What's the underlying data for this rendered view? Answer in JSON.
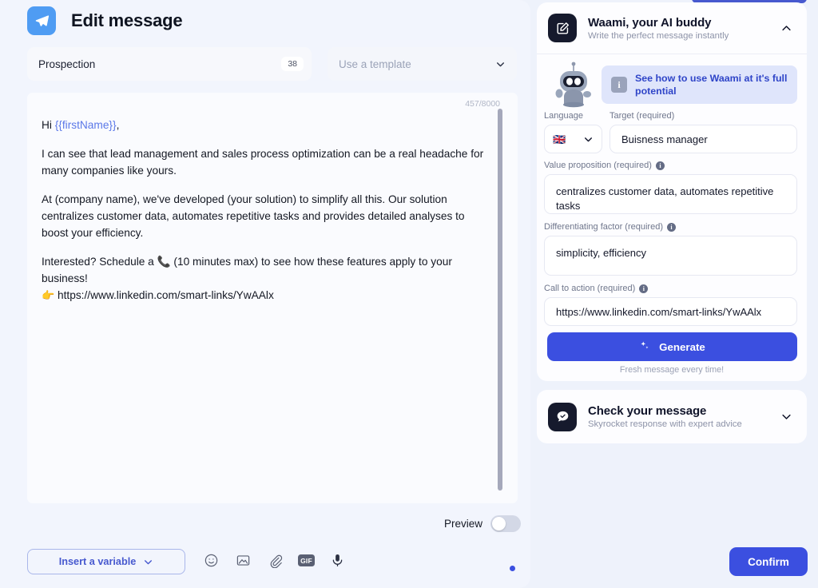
{
  "header": {
    "title": "Edit message",
    "logo_icon": "paper-plane-icon"
  },
  "subject": {
    "value": "Prospection",
    "char_count": "38"
  },
  "template": {
    "placeholder": "Use a template",
    "chevron_icon": "chevron-down-icon"
  },
  "editor": {
    "char_counter": "457/8000",
    "greeting_prefix": "Hi ",
    "variable_token": "{{firstName}}",
    "greeting_suffix": ",",
    "paragraph_1": "I can see that lead management and sales process optimization can be a real headache for many companies like yours.",
    "paragraph_2": "At (company name), we've developed (your solution) to simplify all this. Our solution centralizes customer data, automates repetitive tasks and provides detailed analyses to boost your efficiency.",
    "paragraph_3": "Interested? Schedule a 📞 (10 minutes max) to see how these features apply to your business!",
    "link_emoji": "👉",
    "link_text": "https://www.linkedin.com/smart-links/YwAAlx"
  },
  "preview": {
    "label": "Preview",
    "enabled": false
  },
  "toolbar": {
    "insert_variable_label": "Insert a variable",
    "icons": [
      {
        "name": "emoji-icon",
        "label": "Emoji"
      },
      {
        "name": "image-icon",
        "label": "Image"
      },
      {
        "name": "attachment-icon",
        "label": "Attachment"
      },
      {
        "name": "gif-icon",
        "label": "GIF"
      },
      {
        "name": "microphone-icon",
        "label": "Voice note"
      }
    ],
    "gif_label": "GIF",
    "confirm_label": "Confirm"
  },
  "waami": {
    "title": "Waami, your AI buddy",
    "subtitle": "Write the perfect message instantly",
    "badge_icon": "compose-square-icon",
    "collapse_icon": "chevron-up-icon",
    "mascot_icon": "robot-mascot-icon",
    "banner": {
      "icon": "info-icon",
      "text": "See how to use Waami at it's full potential"
    },
    "language": {
      "label": "Language",
      "flag_glyph": "🇬🇧",
      "chevron_icon": "chevron-down-icon"
    },
    "target": {
      "label": "Target (required)",
      "value": "Buisness manager"
    },
    "value_proposition": {
      "label": "Value proposition (required)",
      "info_icon": "info-icon",
      "value": "centralizes customer data, automates repetitive tasks"
    },
    "differentiating_factor": {
      "label": "Differentiating factor (required)",
      "info_icon": "info-icon",
      "value": "simplicity, efficiency"
    },
    "call_to_action": {
      "label": "Call to action (required)",
      "info_icon": "info-icon",
      "value": "https://www.linkedin.com/smart-links/YwAAlx"
    },
    "generate_label": "Generate",
    "generate_icon": "sparkle-icon",
    "generate_caption": "Fresh message every time!"
  },
  "check_message": {
    "title": "Check your message",
    "subtitle": "Skyrocket response with expert advice",
    "badge_icon": "chat-check-icon",
    "expand_icon": "chevron-down-icon"
  },
  "colors": {
    "accent_blue": "#3b4fe0",
    "link_blue": "#2f45c8",
    "logo_blue": "#4f9cf3",
    "panel_bg": "#f2f5fd",
    "page_bg": "#eef2fb",
    "dark_badge": "#161a2d"
  }
}
